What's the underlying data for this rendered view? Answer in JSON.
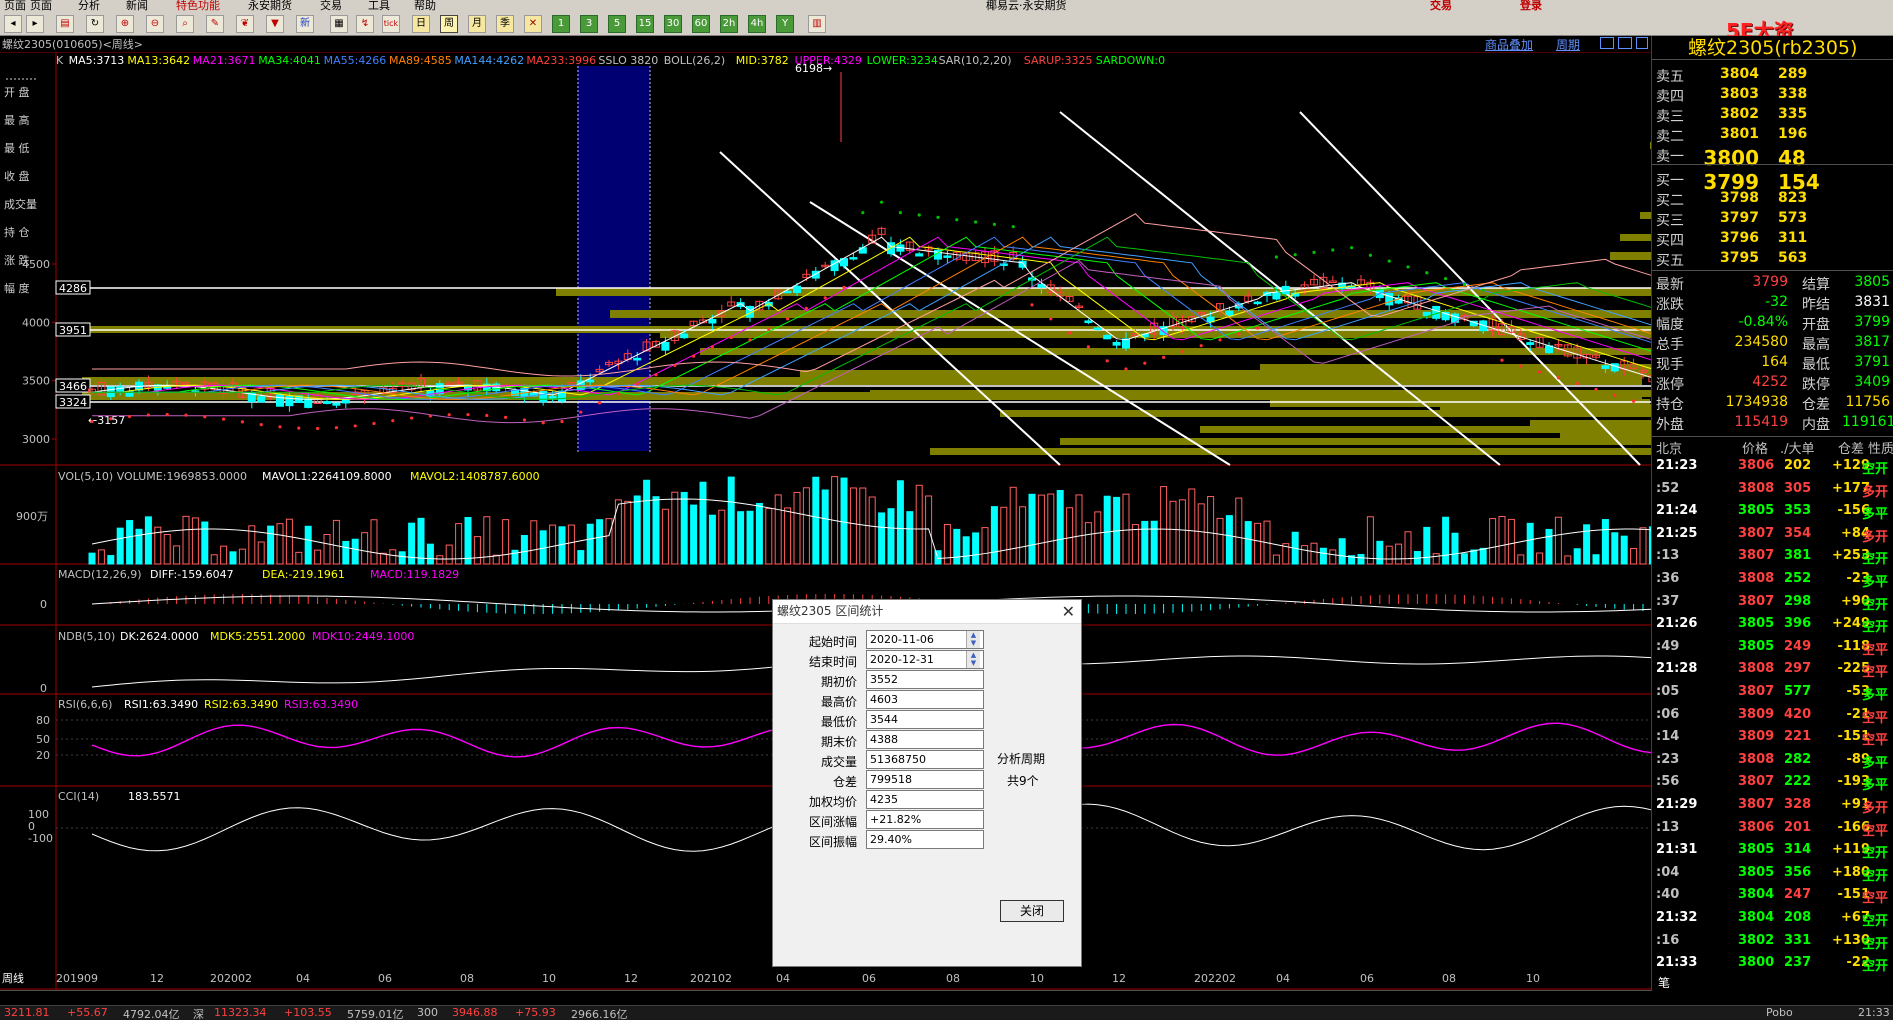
{
  "menubar": {
    "items": [
      "页面",
      "分析",
      "新闻",
      "特色功能",
      "永安期货",
      "交易",
      "工具",
      "帮助"
    ],
    "promo": "椰易云·永安期货",
    "trade_btn": "交易",
    "login": "登录"
  },
  "watermark": "5E大资5etz.com",
  "toolbar": {
    "buttons": [
      "1",
      "3",
      "5",
      "15",
      "30",
      "60",
      "2h",
      "4h",
      "Y"
    ],
    "period_labels": [
      "日",
      "周",
      "月",
      "季"
    ]
  },
  "chart_header": {
    "symbol_line": "螺纹2305(010605)<周线>",
    "links": [
      "商品叠加",
      "周期"
    ]
  },
  "indicator_line": {
    "items": [
      {
        "text": "K",
        "color": "#c0c0c0"
      },
      {
        "text": "MA5:3713",
        "color": "#ffffff"
      },
      {
        "text": "MA13:3642",
        "color": "#ffff00"
      },
      {
        "text": "MA21:3671",
        "color": "#ff00ff"
      },
      {
        "text": "MA34:4041",
        "color": "#00ff00"
      },
      {
        "text": "MA55:4266",
        "color": "#4080ff"
      },
      {
        "text": "MA89:4585",
        "color": "#ff8000"
      },
      {
        "text": "MA144:4262",
        "color": "#40a0ff"
      },
      {
        "text": "MA233:3996",
        "color": "#ff4040"
      },
      {
        "text": "SSLO 3820",
        "color": "#c0c0c0"
      },
      {
        "text": "BOLL(26,2)",
        "color": "#c0c0c0"
      },
      {
        "text": "MID:3782",
        "color": "#ffff00"
      },
      {
        "text": "UPPER:4329",
        "color": "#ff00ff"
      },
      {
        "text": "LOWER:3234",
        "color": "#00ff00"
      },
      {
        "text": "SAR(10,2,20)",
        "color": "#c0c0c0"
      },
      {
        "text": "SARUP:3325",
        "color": "#ff4040"
      },
      {
        "text": "SARDOWN:0",
        "color": "#00ff00"
      }
    ]
  },
  "left_labels": [
    "开 盘",
    "最 高",
    "最 低",
    "收 盘",
    "成交量",
    "持 仓",
    "涨 跌",
    "幅 度"
  ],
  "y_axis_main": [
    "4500",
    "4000",
    "3500",
    "3000"
  ],
  "price_markers": [
    "4286",
    "3951",
    "3466",
    "3324"
  ],
  "peak_label": "6198",
  "low_label": "3157",
  "sub_panels": {
    "vol": {
      "title": "VOL(5,10) VOLUME:1969853.0000",
      "mavol1": "MAVOL1:2264109.8000",
      "mavol2": "MAVOL2:1408787.6000",
      "y": "900万"
    },
    "macd": {
      "title": "MACD(12,26,9)",
      "diff": "DIFF:-159.6047",
      "dea": "DEA:-219.1961",
      "macd": "MACD:119.1829",
      "y": "0"
    },
    "ndb": {
      "title": "NDB(5,10)",
      "dk": "DK:2624.0000",
      "mdk5": "MDK5:2551.2000",
      "mdk10": "MDK10:2449.1000",
      "y": "0"
    },
    "rsi": {
      "title": "RSI(6,6,6)",
      "rsi1": "RSI1:63.3490",
      "rsi2": "RSI2:63.3490",
      "rsi3": "RSI3:63.3490",
      "y": [
        "80",
        "50",
        "20"
      ]
    },
    "cci": {
      "title": "CCI(14)",
      "value": "183.5571",
      "y": [
        "100",
        "0",
        "-100"
      ]
    }
  },
  "x_axis": [
    "周线",
    "201909",
    "12",
    "202002",
    "04",
    "06",
    "08",
    "10",
    "12",
    "202102",
    "04",
    "06",
    "08",
    "10",
    "12",
    "202202",
    "04",
    "06",
    "08",
    "10"
  ],
  "dialog": {
    "title": "螺纹2305 区间统计",
    "fields": [
      {
        "label": "起始时间",
        "value": "2020-11-06"
      },
      {
        "label": "结束时间",
        "value": "2020-12-31"
      },
      {
        "label": "期初价",
        "value": "3552"
      },
      {
        "label": "最高价",
        "value": "4603"
      },
      {
        "label": "最低价",
        "value": "3544"
      },
      {
        "label": "期末价",
        "value": "4388"
      },
      {
        "label": "成交量",
        "value": "51368750"
      },
      {
        "label": "仓差",
        "value": "799518"
      },
      {
        "label": "加权均价",
        "value": "4235"
      },
      {
        "label": "区间涨幅",
        "value": "+21.82%"
      },
      {
        "label": "区间振幅",
        "value": "29.40%"
      }
    ],
    "side_text1": "分析周期",
    "side_text2": "共9个",
    "close_label": "关闭"
  },
  "quote": {
    "title": "螺纹2305(rb2305)",
    "asks": [
      {
        "label": "卖五",
        "price": "3804",
        "vol": "289"
      },
      {
        "label": "卖四",
        "price": "3803",
        "vol": "338"
      },
      {
        "label": "卖三",
        "price": "3802",
        "vol": "335"
      },
      {
        "label": "卖二",
        "price": "3801",
        "vol": "196"
      },
      {
        "label": "卖一",
        "price": "3800",
        "vol": "48"
      }
    ],
    "bids": [
      {
        "label": "买一",
        "price": "3799",
        "vol": "154"
      },
      {
        "label": "买二",
        "price": "3798",
        "vol": "823"
      },
      {
        "label": "买三",
        "price": "3797",
        "vol": "573"
      },
      {
        "label": "买四",
        "price": "3796",
        "vol": "311"
      },
      {
        "label": "买五",
        "price": "3795",
        "vol": "563"
      }
    ],
    "stats": [
      {
        "l1": "最新",
        "v1": "3799",
        "c1": "#ff4040",
        "l2": "结算",
        "v2": "3805",
        "c2": "#00ff00"
      },
      {
        "l1": "涨跌",
        "v1": "-32",
        "c1": "#00ff00",
        "l2": "昨结",
        "v2": "3831",
        "c2": "#ffffff"
      },
      {
        "l1": "幅度",
        "v1": "-0.84%",
        "c1": "#00ff00",
        "l2": "开盘",
        "v2": "3799",
        "c2": "#00ff00"
      },
      {
        "l1": "总手",
        "v1": "234580",
        "c1": "#ffdd00",
        "l2": "最高",
        "v2": "3817",
        "c2": "#00ff00"
      },
      {
        "l1": "现手",
        "v1": "164",
        "c1": "#ffdd00",
        "l2": "最低",
        "v2": "3791",
        "c2": "#00ff00"
      },
      {
        "l1": "涨停",
        "v1": "4252",
        "c1": "#ff4040",
        "l2": "跌停",
        "v2": "3409",
        "c2": "#00ff00"
      },
      {
        "l1": "持仓",
        "v1": "1734938",
        "c1": "#ffdd00",
        "l2": "仓差",
        "v2": "11756",
        "c2": "#ffdd00"
      },
      {
        "l1": "外盘",
        "v1": "115419",
        "c1": "#ff4040",
        "l2": "内盘",
        "v2": "119161",
        "c2": "#00ff00"
      }
    ],
    "tick_header": [
      "北京",
      "价格",
      "./大单",
      "仓差",
      "性质"
    ],
    "ticks": [
      {
        "t": "21:23",
        "p": "3806",
        "v": "202",
        "d": "+129",
        "n": "空开",
        "pc": "#ff4040",
        "vc": "#ffdd00",
        "dc": "#ffdd00",
        "nc": "#00ff00"
      },
      {
        "t": ":52",
        "p": "3808",
        "v": "305",
        "d": "+177",
        "n": "多开",
        "pc": "#ff4040",
        "vc": "#ff4040",
        "dc": "#ffdd00",
        "nc": "#ff4040"
      },
      {
        "t": "21:24",
        "p": "3805",
        "v": "353",
        "d": "-156",
        "n": "多平",
        "pc": "#00ff00",
        "vc": "#00ff00",
        "dc": "#ffdd00",
        "nc": "#00ff00"
      },
      {
        "t": "21:25",
        "p": "3807",
        "v": "354",
        "d": "+84",
        "n": "多开",
        "pc": "#ff4040",
        "vc": "#ff4040",
        "dc": "#ffdd00",
        "nc": "#ff4040"
      },
      {
        "t": ":13",
        "p": "3807",
        "v": "381",
        "d": "+253",
        "n": "空开",
        "pc": "#ff4040",
        "vc": "#00ff00",
        "dc": "#ffdd00",
        "nc": "#00ff00"
      },
      {
        "t": ":36",
        "p": "3808",
        "v": "252",
        "d": "-23",
        "n": "多平",
        "pc": "#ff4040",
        "vc": "#00ff00",
        "dc": "#ffdd00",
        "nc": "#00ff00"
      },
      {
        "t": ":37",
        "p": "3807",
        "v": "298",
        "d": "+90",
        "n": "空开",
        "pc": "#ff4040",
        "vc": "#00ff00",
        "dc": "#ffdd00",
        "nc": "#00ff00"
      },
      {
        "t": "21:26",
        "p": "3805",
        "v": "396",
        "d": "+249",
        "n": "空开",
        "pc": "#00ff00",
        "vc": "#00ff00",
        "dc": "#ffdd00",
        "nc": "#00ff00"
      },
      {
        "t": ":49",
        "p": "3805",
        "v": "249",
        "d": "-118",
        "n": "空平",
        "pc": "#00ff00",
        "vc": "#ff4040",
        "dc": "#ffdd00",
        "nc": "#ff4040"
      },
      {
        "t": "21:28",
        "p": "3808",
        "v": "297",
        "d": "-225",
        "n": "空平",
        "pc": "#ff4040",
        "vc": "#ff4040",
        "dc": "#ffdd00",
        "nc": "#ff4040"
      },
      {
        "t": ":05",
        "p": "3807",
        "v": "577",
        "d": "-53",
        "n": "多平",
        "pc": "#ff4040",
        "vc": "#00ff00",
        "dc": "#ffdd00",
        "nc": "#00ff00"
      },
      {
        "t": ":06",
        "p": "3809",
        "v": "420",
        "d": "-21",
        "n": "空平",
        "pc": "#ff4040",
        "vc": "#ff4040",
        "dc": "#ffdd00",
        "nc": "#ff4040"
      },
      {
        "t": ":14",
        "p": "3809",
        "v": "221",
        "d": "-151",
        "n": "空平",
        "pc": "#ff4040",
        "vc": "#ff4040",
        "dc": "#ffdd00",
        "nc": "#ff4040"
      },
      {
        "t": ":23",
        "p": "3808",
        "v": "282",
        "d": "-89",
        "n": "多平",
        "pc": "#ff4040",
        "vc": "#00ff00",
        "dc": "#ffdd00",
        "nc": "#00ff00"
      },
      {
        "t": ":56",
        "p": "3807",
        "v": "222",
        "d": "-193",
        "n": "多平",
        "pc": "#ff4040",
        "vc": "#00ff00",
        "dc": "#ffdd00",
        "nc": "#00ff00"
      },
      {
        "t": "21:29",
        "p": "3807",
        "v": "328",
        "d": "+91",
        "n": "多开",
        "pc": "#ff4040",
        "vc": "#ff4040",
        "dc": "#ffdd00",
        "nc": "#ff4040"
      },
      {
        "t": ":13",
        "p": "3806",
        "v": "201",
        "d": "-166",
        "n": "空平",
        "pc": "#ff4040",
        "vc": "#ff4040",
        "dc": "#ffdd00",
        "nc": "#ff4040"
      },
      {
        "t": "21:31",
        "p": "3805",
        "v": "314",
        "d": "+119",
        "n": "空开",
        "pc": "#00ff00",
        "vc": "#00ff00",
        "dc": "#ffdd00",
        "nc": "#00ff00"
      },
      {
        "t": ":04",
        "p": "3805",
        "v": "356",
        "d": "+180",
        "n": "空开",
        "pc": "#00ff00",
        "vc": "#00ff00",
        "dc": "#ffdd00",
        "nc": "#00ff00"
      },
      {
        "t": ":40",
        "p": "3804",
        "v": "247",
        "d": "-151",
        "n": "空平",
        "pc": "#00ff00",
        "vc": "#ff4040",
        "dc": "#ffdd00",
        "nc": "#ff4040"
      },
      {
        "t": "21:32",
        "p": "3804",
        "v": "208",
        "d": "+67",
        "n": "空开",
        "pc": "#00ff00",
        "vc": "#00ff00",
        "dc": "#ffdd00",
        "nc": "#00ff00"
      },
      {
        "t": ":16",
        "p": "3802",
        "v": "331",
        "d": "+130",
        "n": "空开",
        "pc": "#00ff00",
        "vc": "#00ff00",
        "dc": "#ffdd00",
        "nc": "#00ff00"
      },
      {
        "t": "21:33",
        "p": "3800",
        "v": "237",
        "d": "-22",
        "n": "空开",
        "pc": "#00ff00",
        "vc": "#00ff00",
        "dc": "#ffdd00",
        "nc": "#00ff00"
      }
    ],
    "tab": "笔"
  },
  "statusbar": {
    "items": [
      {
        "text": "3211.81",
        "color": "#ff4040"
      },
      {
        "text": "+55.67",
        "color": "#ff4040"
      },
      {
        "text": "4792.04亿",
        "color": "#c0c0c0"
      },
      {
        "text": "深",
        "color": "#c0c0c0"
      },
      {
        "text": "11323.34",
        "color": "#ff4040"
      },
      {
        "text": "+103.55",
        "color": "#ff4040"
      },
      {
        "text": "5759.01亿",
        "color": "#c0c0c0"
      },
      {
        "text": "300",
        "color": "#c0c0c0"
      },
      {
        "text": "3946.88",
        "color": "#ff4040"
      },
      {
        "text": "+75.93",
        "color": "#ff4040"
      },
      {
        "text": "2966.16亿",
        "color": "#c0c0c0"
      }
    ],
    "right": "Pobo",
    "clock": "21:33"
  },
  "colors": {
    "up": "#ff4040",
    "down": "#00ffff",
    "volbar": "#ff6060",
    "sar_up": "#ff3030",
    "sar_down": "#00c000",
    "highlight": "#000080",
    "olive": "#808000"
  }
}
